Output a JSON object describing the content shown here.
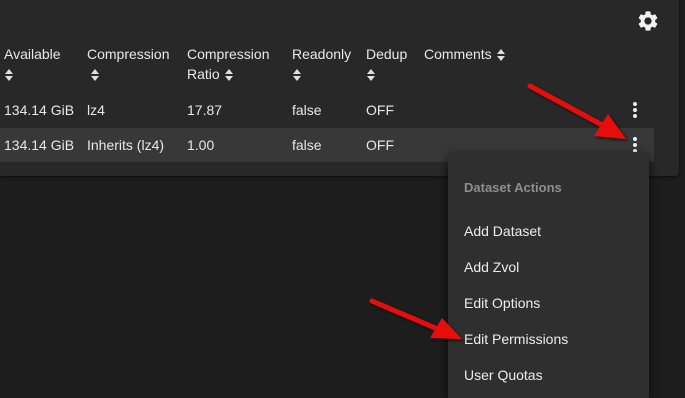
{
  "columns": [
    {
      "label_line1": "Available",
      "label_line2": ""
    },
    {
      "label_line1": "Compression",
      "label_line2": ""
    },
    {
      "label_line1": "Compression",
      "label_line2": "Ratio"
    },
    {
      "label_line1": "Readonly",
      "label_line2": ""
    },
    {
      "label_line1": "Dedup",
      "label_line2": ""
    },
    {
      "label_line1": "Comments",
      "label_line2": ""
    }
  ],
  "rows": [
    {
      "available": "134.14 GiB",
      "compression": "lz4",
      "ratio": "17.87",
      "readonly": "false",
      "dedup": "OFF",
      "comments": ""
    },
    {
      "available": "134.14 GiB",
      "compression": "Inherits (lz4)",
      "ratio": "1.00",
      "readonly": "false",
      "dedup": "OFF",
      "comments": ""
    }
  ],
  "menu": {
    "title": "Dataset Actions",
    "items": [
      {
        "label": "Add Dataset"
      },
      {
        "label": "Add Zvol"
      },
      {
        "label": "Edit Options"
      },
      {
        "label": "Edit Permissions"
      },
      {
        "label": "User Quotas"
      }
    ]
  },
  "icons": {
    "settings": "gear-icon",
    "row_actions": "more-vertical-icon",
    "sort": "sort-icon",
    "annotation": "red-arrow"
  },
  "colors": {
    "background": "#1d1d1d",
    "card": "#282828",
    "selected_row": "#383838",
    "menu": "#2f2f2f",
    "text": "#e8e8e8",
    "menu_title": "#8e8e8e",
    "arrow": "#e81010"
  }
}
